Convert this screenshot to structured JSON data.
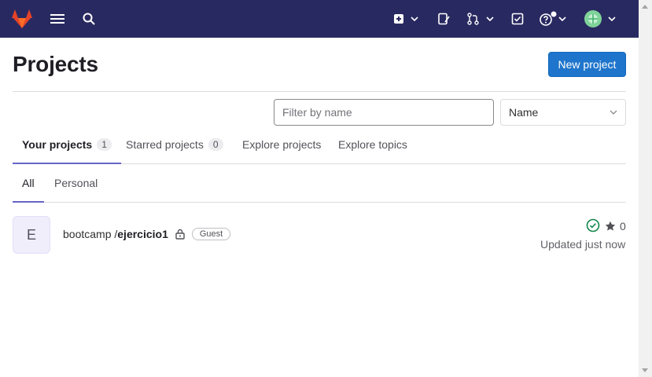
{
  "header": {
    "title": "Projects",
    "new_project_label": "New project"
  },
  "filter": {
    "placeholder": "Filter by name",
    "sort_selected": "Name"
  },
  "tabs": [
    {
      "label": "Your projects",
      "count": "1"
    },
    {
      "label": "Starred projects",
      "count": "0"
    },
    {
      "label": "Explore projects"
    },
    {
      "label": "Explore topics"
    }
  ],
  "subtabs": [
    {
      "label": "All"
    },
    {
      "label": "Personal"
    }
  ],
  "project": {
    "avatar_letter": "E",
    "namespace": "bootcamp / ",
    "name": "ejercicio1",
    "role": "Guest",
    "stars": "0",
    "updated": "Updated just now"
  },
  "icons": {
    "logo": "gitlab-tanuki-logo",
    "menu": "hamburger-menu-icon",
    "search": "search-icon",
    "create": "plus-square-icon",
    "issues": "issues-icon",
    "merge_requests": "merge-request-icon",
    "todos": "todo-icon",
    "help": "help-icon",
    "avatar": "user-avatar",
    "lock": "lock-icon",
    "status": "pipeline-passed-icon",
    "star": "star-icon"
  },
  "colors": {
    "navbar": "#292961",
    "primary_button": "#1f75cb",
    "tab_active_underline": "#6666c4",
    "status_success": "#108548"
  }
}
